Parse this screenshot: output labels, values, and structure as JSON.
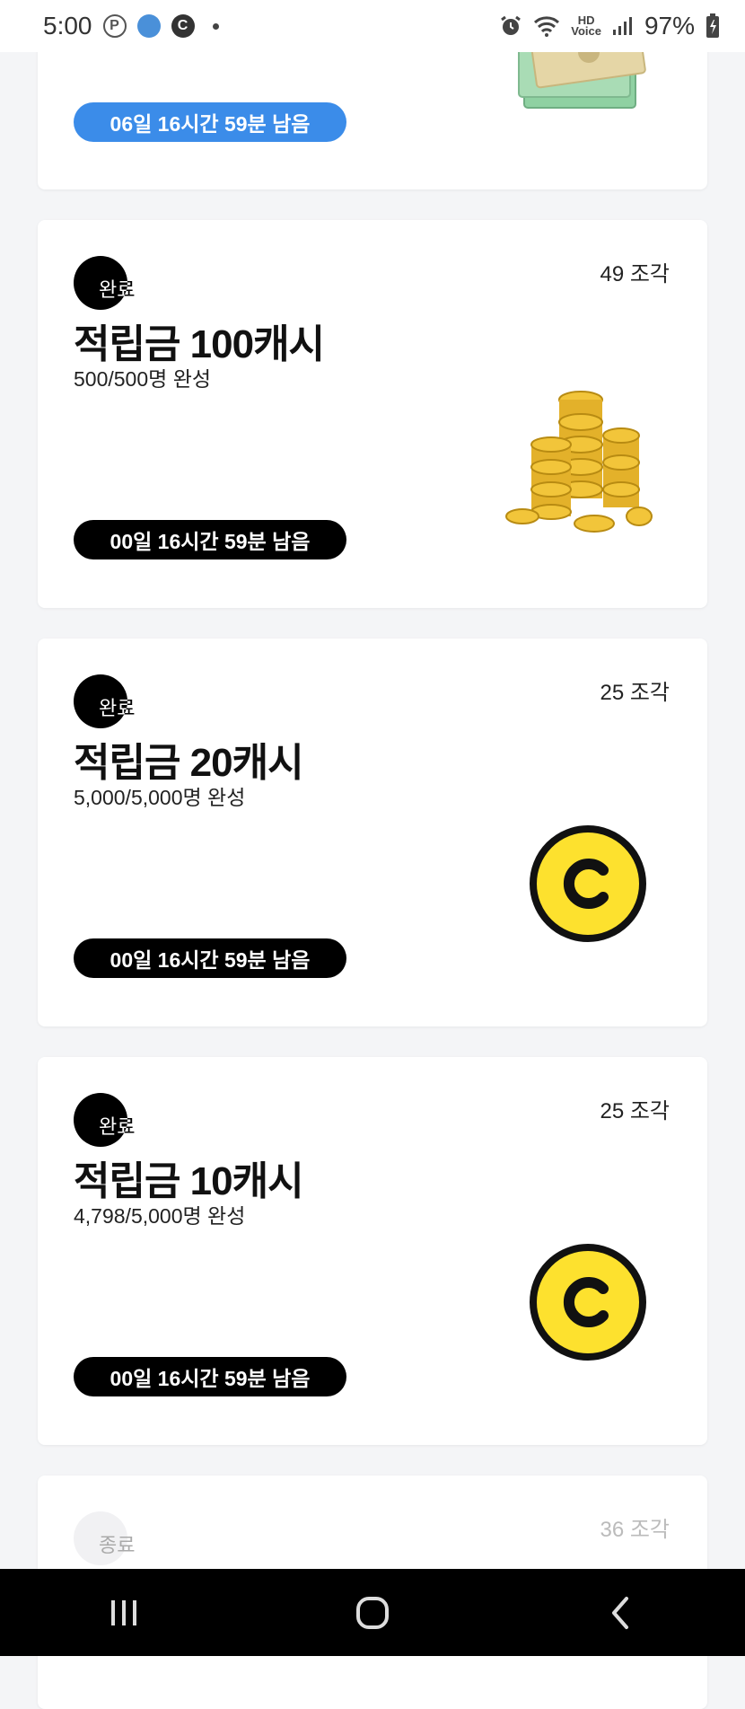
{
  "status_bar": {
    "time": "5:00",
    "icons": [
      "parking-p-icon",
      "globe-icon",
      "c-app-icon",
      "dot-icon"
    ],
    "right_icons": [
      "alarm-icon",
      "wifi-icon",
      "hd-voice-icon",
      "signal-icon",
      "battery-icon"
    ],
    "hd_label": "HD",
    "voice_label": "Voice",
    "battery": "97%"
  },
  "cards": [
    {
      "timer": "06일 16시간 59분 남음",
      "timer_color": "#3b8ce9",
      "image": "cash-bills-icon"
    },
    {
      "pieces": "49 조각",
      "badge": "완료",
      "title": "적립금 100캐시",
      "progress": "500/500명 완성",
      "timer": "00일 16시간 59분 남음",
      "image": "gold-coins-icon"
    },
    {
      "pieces": "25 조각",
      "badge": "완료",
      "title": "적립금 20캐시",
      "progress": "5,000/5,000명 완성",
      "timer": "00일 16시간 59분 남음",
      "image": "c-coin-icon"
    },
    {
      "pieces": "25 조각",
      "badge": "완료",
      "title": "적립금 10캐시",
      "progress": "4,798/5,000명 완성",
      "timer": "00일 16시간 59분 남음",
      "image": "c-coin-icon"
    },
    {
      "pieces": "36 조각",
      "badge": "종료"
    }
  ],
  "nav_bar": {
    "buttons": [
      "recent-apps-icon",
      "home-icon",
      "back-icon"
    ]
  },
  "colors": {
    "accent_blue": "#3b8ce9",
    "coin_yellow": "#fde12e",
    "background": "#f4f5f7"
  }
}
